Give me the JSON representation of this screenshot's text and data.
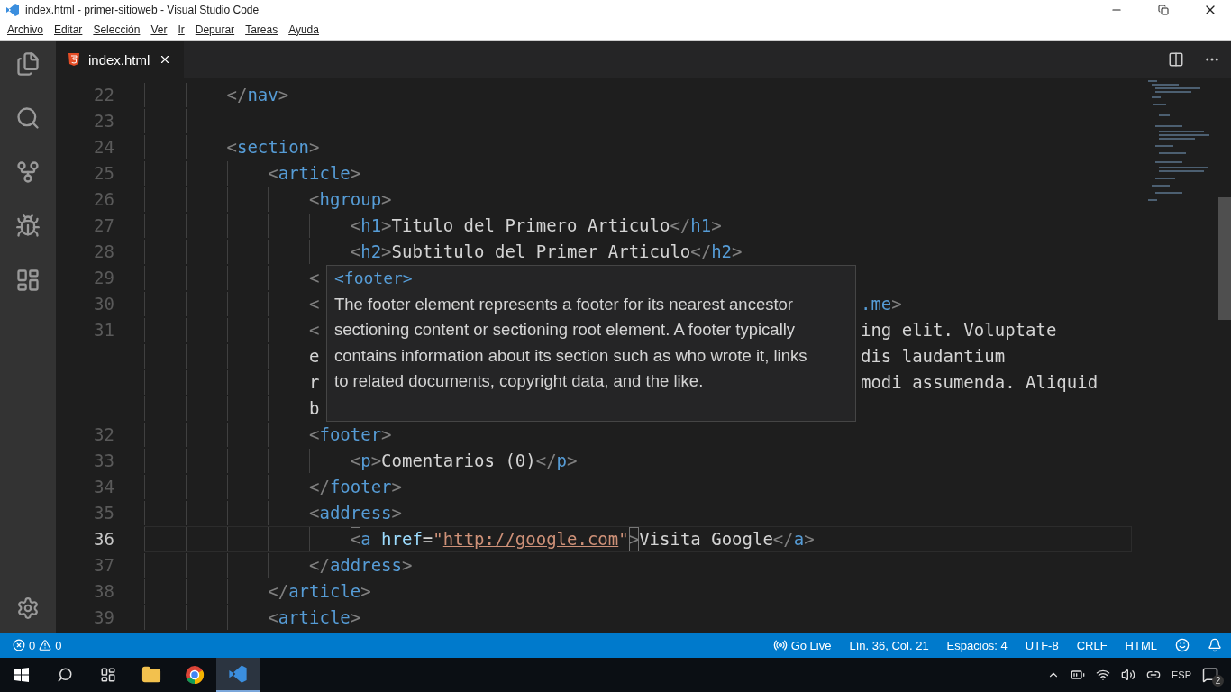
{
  "window": {
    "title": "index.html - primer-sitioweb - Visual Studio Code"
  },
  "menu": [
    "Archivo",
    "Editar",
    "Selección",
    "Ver",
    "Ir",
    "Depurar",
    "Tareas",
    "Ayuda"
  ],
  "tabs": [
    {
      "label": "index.html",
      "selected": true
    }
  ],
  "lines": [
    {
      "number": "22",
      "tokens": [
        {
          "kind": "punct",
          "text": "</"
        },
        {
          "kind": "tag",
          "text": "nav"
        },
        {
          "kind": "punct",
          "text": ">"
        }
      ]
    },
    {
      "number": "23"
    },
    {
      "number": "24",
      "tokens": [
        {
          "kind": "punct",
          "text": "<"
        },
        {
          "kind": "tag",
          "text": "section"
        },
        {
          "kind": "punct",
          "text": ">"
        }
      ],
      "children": [
        {
          "number": "25",
          "tokens": [
            {
              "kind": "punct",
              "text": "<"
            },
            {
              "kind": "tag",
              "text": "article"
            },
            {
              "kind": "punct",
              "text": ">"
            }
          ],
          "children": [
            {
              "number": "26",
              "tokens": [
                {
                  "kind": "punct",
                  "text": "<"
                },
                {
                  "kind": "tag",
                  "text": "hgroup"
                },
                {
                  "kind": "punct",
                  "text": ">"
                }
              ],
              "children": [
                {
                  "number": "27",
                  "tokens": [
                    {
                      "kind": "punct",
                      "text": "<"
                    },
                    {
                      "kind": "tag",
                      "text": "h1"
                    },
                    {
                      "kind": "punct",
                      "text": ">"
                    },
                    {
                      "kind": "text",
                      "text": "Titulo del Primero Articulo"
                    },
                    {
                      "kind": "punct",
                      "text": "</"
                    },
                    {
                      "kind": "tag",
                      "text": "h1"
                    },
                    {
                      "kind": "punct",
                      "text": ">"
                    }
                  ]
                },
                {
                  "number": "28",
                  "tokens": [
                    {
                      "kind": "punct",
                      "text": "<"
                    },
                    {
                      "kind": "tag",
                      "text": "h2"
                    },
                    {
                      "kind": "punct",
                      "text": ">"
                    },
                    {
                      "kind": "text",
                      "text": "Subtitulo del Primer Articulo"
                    },
                    {
                      "kind": "punct",
                      "text": "</"
                    },
                    {
                      "kind": "tag",
                      "text": "h2"
                    },
                    {
                      "kind": "punct",
                      "text": ">"
                    }
                  ]
                }
              ]
            },
            {
              "number": "29",
              "tokens": [
                {
                  "kind": "punct",
                  "text": "<"
                }
              ]
            },
            {
              "number": "30",
              "tokens": [
                {
                  "kind": "punct",
                  "text": "<"
                }
              ],
              "tail": [
                {
                  "kind": "tag",
                  "text": ".me"
                },
                {
                  "kind": "punct",
                  "text": ">"
                }
              ]
            },
            {
              "number": "31",
              "tokens": [
                {
                  "kind": "punct",
                  "text": "<"
                }
              ],
              "tail": [
                {
                  "kind": "text",
                  "text": "ing elit. Voluptate"
                }
              ]
            },
            {
              "tokens": [
                {
                  "kind": "text",
                  "text": "e"
                }
              ],
              "tail": [
                {
                  "kind": "text",
                  "text": "dis laudantium"
                }
              ]
            },
            {
              "tokens": [
                {
                  "kind": "text",
                  "text": "r"
                }
              ],
              "tail": [
                {
                  "kind": "text",
                  "text": "modi assumenda. Aliquid"
                }
              ]
            },
            {
              "tokens": [
                {
                  "kind": "text",
                  "text": "b"
                }
              ]
            },
            {
              "number": "32",
              "tokens": [
                {
                  "kind": "punct",
                  "text": "<"
                },
                {
                  "kind": "tag",
                  "text": "footer"
                },
                {
                  "kind": "punct",
                  "text": ">"
                }
              ],
              "children": [
                {
                  "number": "33",
                  "tokens": [
                    {
                      "kind": "punct",
                      "text": "<"
                    },
                    {
                      "kind": "tag",
                      "text": "p"
                    },
                    {
                      "kind": "punct",
                      "text": ">"
                    },
                    {
                      "kind": "text",
                      "text": "Comentarios (0)"
                    },
                    {
                      "kind": "punct",
                      "text": "</"
                    },
                    {
                      "kind": "tag",
                      "text": "p"
                    },
                    {
                      "kind": "punct",
                      "text": ">"
                    }
                  ]
                }
              ]
            },
            {
              "number": "34",
              "tokens": [
                {
                  "kind": "punct",
                  "text": "</"
                },
                {
                  "kind": "tag",
                  "text": "footer"
                },
                {
                  "kind": "punct",
                  "text": ">"
                }
              ]
            },
            {
              "number": "35",
              "tokens": [
                {
                  "kind": "punct",
                  "text": "<"
                },
                {
                  "kind": "tag",
                  "text": "address"
                },
                {
                  "kind": "punct",
                  "text": ">"
                }
              ],
              "children": [
                {
                  "number": "36",
                  "current": true,
                  "tokens": [
                    {
                      "kind": "bracket",
                      "text": "<"
                    },
                    {
                      "kind": "tag",
                      "text": "a"
                    },
                    {
                      "kind": "attr",
                      "text": "href"
                    },
                    {
                      "kind": "text",
                      "text": "="
                    },
                    {
                      "kind": "string",
                      "text": "\""
                    },
                    {
                      "kind": "link",
                      "text": "http://google.com"
                    },
                    {
                      "kind": "string",
                      "text": "\""
                    },
                    {
                      "kind": "bracket",
                      "text": ">"
                    },
                    {
                      "kind": "text",
                      "text": "Visita Google"
                    },
                    {
                      "kind": "punct",
                      "text": "</"
                    },
                    {
                      "kind": "tag",
                      "text": "a"
                    },
                    {
                      "kind": "punct",
                      "text": ">"
                    }
                  ]
                }
              ]
            },
            {
              "number": "37",
              "tokens": [
                {
                  "kind": "punct",
                  "text": "</"
                },
                {
                  "kind": "tag",
                  "text": "address"
                },
                {
                  "kind": "punct",
                  "text": ">"
                }
              ]
            }
          ]
        },
        {
          "number": "38",
          "tokens": [
            {
              "kind": "punct",
              "text": "</"
            },
            {
              "kind": "tag",
              "text": "article"
            },
            {
              "kind": "punct",
              "text": ">"
            }
          ]
        },
        {
          "number": "39",
          "tokens": [
            {
              "kind": "punct",
              "text": "<"
            },
            {
              "kind": "tag",
              "text": "article"
            },
            {
              "kind": "punct",
              "text": ">"
            }
          ]
        }
      ]
    }
  ],
  "hover": {
    "signature": "<footer>",
    "text": "The footer element represents a footer for its nearest ancestor sectioning content or sectioning root element. A footer typically contains information about its section such as who wrote it, links to related documents, copyright data, and the like."
  },
  "status_bar": {
    "errors": "0",
    "warnings": "0",
    "items": [
      "Go Live",
      "Lín. 36, Col. 21",
      "Espacios: 4",
      "UTF-8",
      "CRLF",
      "HTML"
    ]
  },
  "taskbar": {
    "language": "ESP",
    "notifications": "2"
  }
}
